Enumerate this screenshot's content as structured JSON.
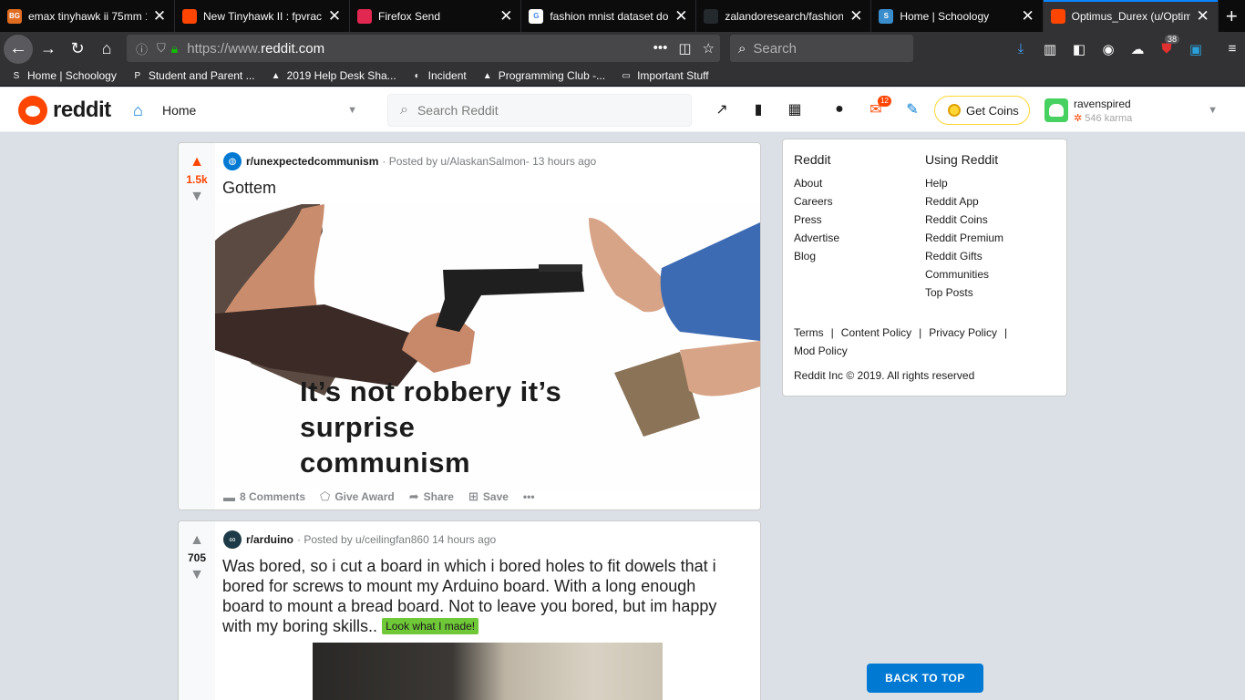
{
  "browser": {
    "tabs": [
      {
        "label": "emax tinyhawk ii 75mm 1",
        "favicon_text": "BG",
        "favicon_color": "#e06c22",
        "active": false
      },
      {
        "label": "New Tinyhawk II : fpvraci",
        "favicon_text": "",
        "favicon_color": "#ff4500",
        "active": false
      },
      {
        "label": "Firefox Send",
        "favicon_text": "",
        "favicon_color": "#e22850",
        "active": false
      },
      {
        "label": "fashion mnist dataset do",
        "favicon_text": "G",
        "favicon_color": "#ffffff",
        "active": false
      },
      {
        "label": "zalandoresearch/fashion",
        "favicon_text": "",
        "favicon_color": "#24292e",
        "active": false
      },
      {
        "label": "Home | Schoology",
        "favicon_text": "S",
        "favicon_color": "#3a8dcc",
        "active": false
      },
      {
        "label": "Optimus_Durex (u/Optim",
        "favicon_text": "",
        "favicon_color": "#ff4500",
        "active": true
      }
    ],
    "new_tab_symbol": "+",
    "close_symbol": "✕",
    "url_prefix": "https://www.",
    "url_domain": "reddit.com",
    "url_more": "•••",
    "search_placeholder": "Search",
    "badge_count": "38"
  },
  "bookmarks": [
    {
      "label": "Home | Schoology",
      "icon": "schoology-icon",
      "glyph": "S"
    },
    {
      "label": "Student and Parent ...",
      "icon": "p-icon",
      "glyph": "P"
    },
    {
      "label": "2019 Help Desk Sha...",
      "icon": "drive-icon",
      "glyph": "▲"
    },
    {
      "label": "Incident",
      "icon": "incident-icon",
      "glyph": "◐"
    },
    {
      "label": "Programming Club -...",
      "icon": "drive-icon",
      "glyph": "▲"
    },
    {
      "label": "Important Stuff",
      "icon": "folder-icon",
      "glyph": "▭"
    }
  ],
  "reddit_header": {
    "logo_text": "reddit",
    "home_label": "Home",
    "search_placeholder": "Search Reddit",
    "mail_badge": "12",
    "get_coins": "Get Coins",
    "username": "ravenspired",
    "karma": "546 karma"
  },
  "posts": [
    {
      "subreddit": "r/unexpectedcommunism",
      "byline": "· Posted by u/AlaskanSalmon- 13 hours ago",
      "score": "1.5k",
      "title": "Gottem",
      "image_caption": [
        "It’s not robbery it’s",
        "surprise",
        "communism"
      ],
      "comments": "8 Comments",
      "award": "Give Award",
      "share": "Share",
      "save": "Save",
      "more": "•••"
    },
    {
      "subreddit": "r/arduino",
      "byline": "· Posted by u/ceilingfan860 14 hours ago",
      "score": "705",
      "title": "Was bored, so i cut a board in which i bored holes to fit dowels that i bored for screws to mount my Arduino board. With a long enough board to mount a bread board. Not to leave you bored, but im happy with my boring skills..",
      "flair": "Look what I made!"
    }
  ],
  "sidebar": {
    "col1_head": "Reddit",
    "col1_links": [
      "About",
      "Careers",
      "Press",
      "Advertise",
      "Blog"
    ],
    "col2_head": "Using Reddit",
    "col2_links": [
      "Help",
      "Reddit App",
      "Reddit Coins",
      "Reddit Premium",
      "Reddit Gifts",
      "Communities",
      "Top Posts"
    ],
    "legal": [
      "Terms",
      "Content Policy",
      "Privacy Policy",
      "Mod Policy"
    ],
    "legal_sep": "|",
    "copyright": "Reddit Inc © 2019. All rights reserved"
  },
  "back_to_top": "BACK TO TOP",
  "colors": {
    "accent": "#0079d3",
    "upvote": "#ff4500",
    "flair": "#6fc837"
  }
}
